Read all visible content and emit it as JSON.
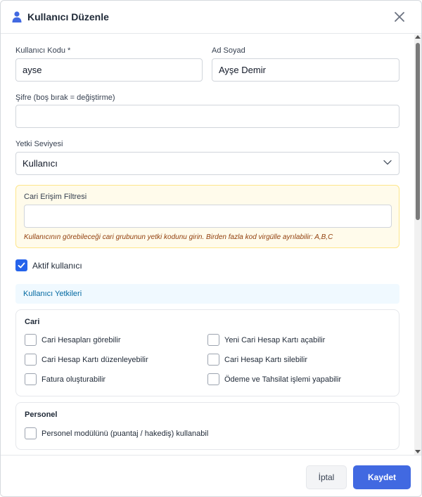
{
  "modal": {
    "title": "Kullanıcı Düzenle",
    "accent_color": "#4169e1"
  },
  "form": {
    "user_code": {
      "label": "Kullanıcı Kodu *",
      "value": "ayse"
    },
    "full_name": {
      "label": "Ad Soyad",
      "value": "Ayşe Demir"
    },
    "password": {
      "label": "Şifre (boş bırak = değiştirme)",
      "value": ""
    },
    "role": {
      "label": "Yetki Seviyesi",
      "selected": "Kullanıcı"
    },
    "cari_filter": {
      "label": "Cari Erişim Filtresi",
      "value": "",
      "help": "Kullanıcının görebileceği cari grubunun yetki kodunu girin. Birden fazla kod virgülle ayrılabilir: A,B,C"
    },
    "active": {
      "label": "Aktif kullanıcı",
      "checked": true
    }
  },
  "permissions": {
    "section_title": "Kullanıcı Yetkileri",
    "groups": [
      {
        "title": "Cari",
        "items": [
          {
            "label": "Cari Hesapları görebilir",
            "checked": false
          },
          {
            "label": "Yeni Cari Hesap Kartı açabilir",
            "checked": false
          },
          {
            "label": "Cari Hesap Kartı düzenleyebilir",
            "checked": false
          },
          {
            "label": "Cari Hesap Kartı silebilir",
            "checked": false
          },
          {
            "label": "Fatura oluşturabilir",
            "checked": false
          },
          {
            "label": "Ödeme ve Tahsilat işlemi yapabilir",
            "checked": false
          }
        ]
      },
      {
        "title": "Personel",
        "items": [
          {
            "label": "Personel modülünü (puantaj / hakediş) kullanabil",
            "checked": false
          }
        ]
      }
    ]
  },
  "footer": {
    "cancel_label": "İptal",
    "save_label": "Kaydet"
  }
}
